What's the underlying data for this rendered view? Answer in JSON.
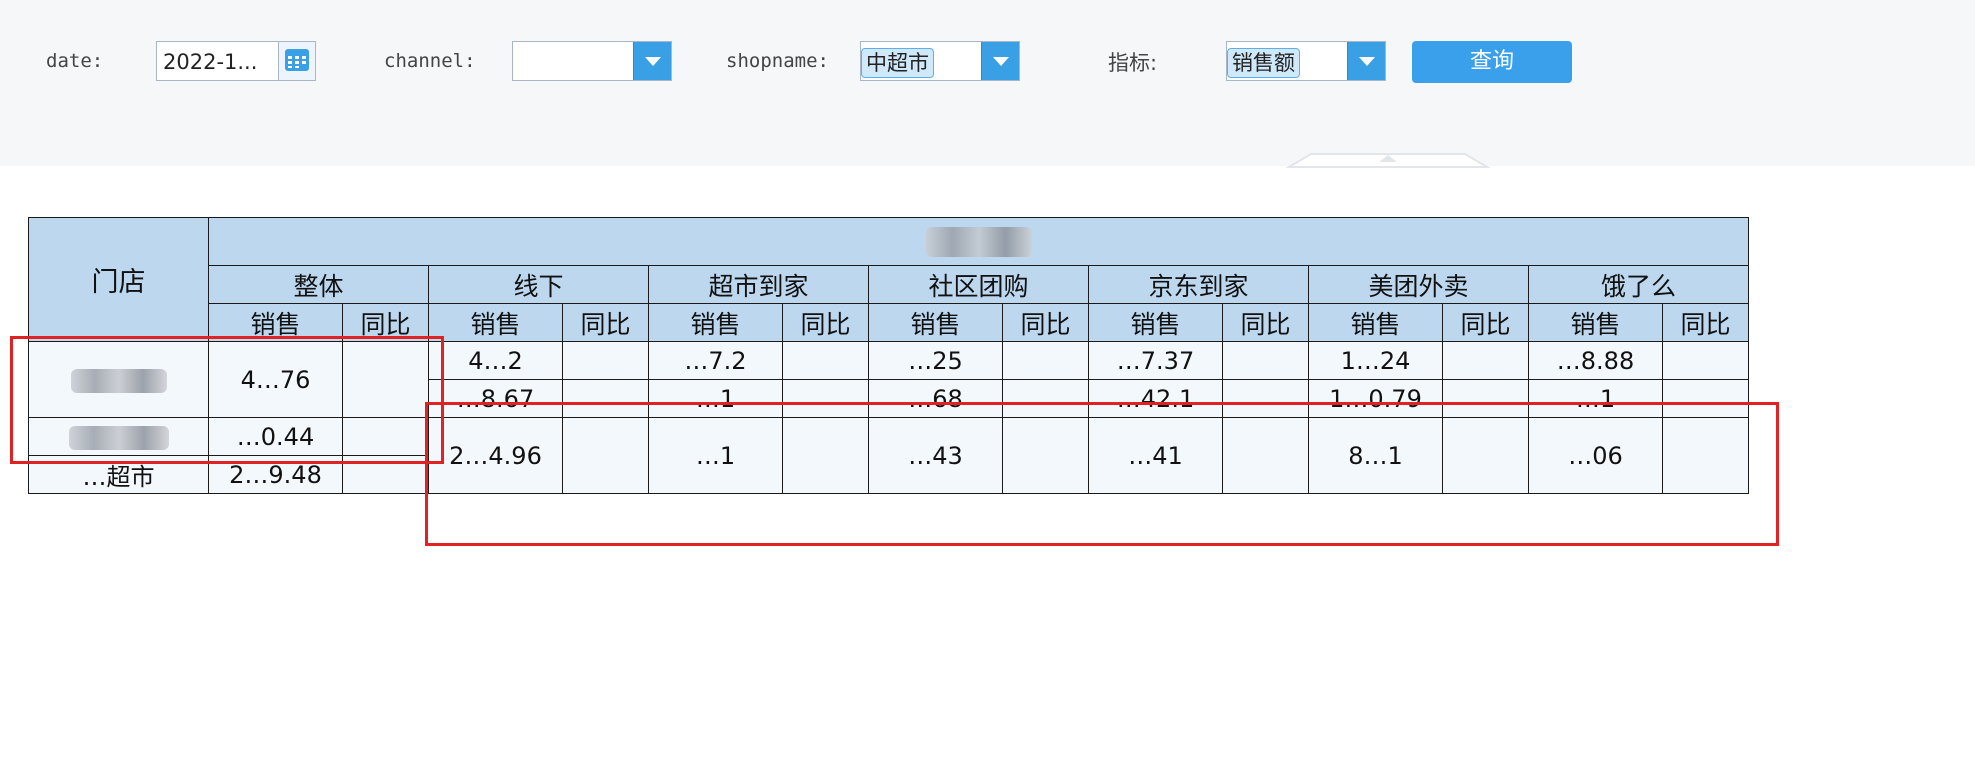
{
  "filters": {
    "date": {
      "label": "date:",
      "value": "2022-1..."
    },
    "channel": {
      "label": "channel:",
      "value": ""
    },
    "shopname": {
      "label": "shopname:",
      "value": "中超市"
    },
    "metric": {
      "label": "指标:",
      "value": "销售额"
    },
    "query_button": "查询"
  },
  "table": {
    "store_header": "门店",
    "group_header": "销售额",
    "channels": [
      "整体",
      "线下",
      "超市到家",
      "社区团购",
      "京东到家",
      "美团外卖",
      "饿了么"
    ],
    "sub_sales": "销售",
    "sub_yoy": "同比",
    "rows": [
      {
        "store": "",
        "overall": "4…76",
        "channel_sales": [
          "4…2",
          "…7.2",
          "…25",
          "…7.37",
          "1…24",
          "…8.88"
        ]
      },
      {
        "store": "",
        "overall": "",
        "channel_sales": [
          "…8.67",
          "…1",
          "…68",
          "…42.1",
          "1…0.79",
          "…1"
        ]
      },
      {
        "store": "",
        "overall": "…0.44",
        "channel_sales": [
          "2…4.96",
          "…1",
          "…43",
          "…41",
          "8…1",
          "…06"
        ]
      },
      {
        "store": "…超市",
        "overall": "2…9.48",
        "channel_sales": []
      }
    ]
  },
  "colors": {
    "header_bg": "#bcd7ee",
    "cell_bg": "#f3f8fd",
    "accent": "#3aa0ec",
    "highlight_box": "#e02222"
  }
}
